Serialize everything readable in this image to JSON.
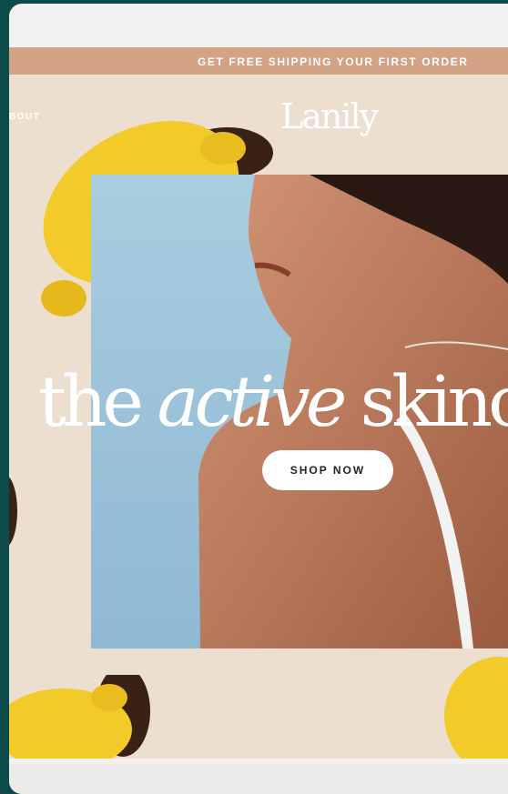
{
  "promo": {
    "text": "GET FREE SHIPPING YOUR FIRST ORDER"
  },
  "nav": {
    "about": "BOUT"
  },
  "brand": {
    "logo": "Lanily"
  },
  "hero": {
    "headline_pre": "the ",
    "headline_em": "active",
    "headline_post": " skinc",
    "cta": "SHOP NOW"
  },
  "colors": {
    "promo_bar": "#d4a285",
    "page_bg": "#ecdfd0",
    "hero_sky": "#9cc3d8",
    "frame_bg": "#0d4a4a"
  }
}
